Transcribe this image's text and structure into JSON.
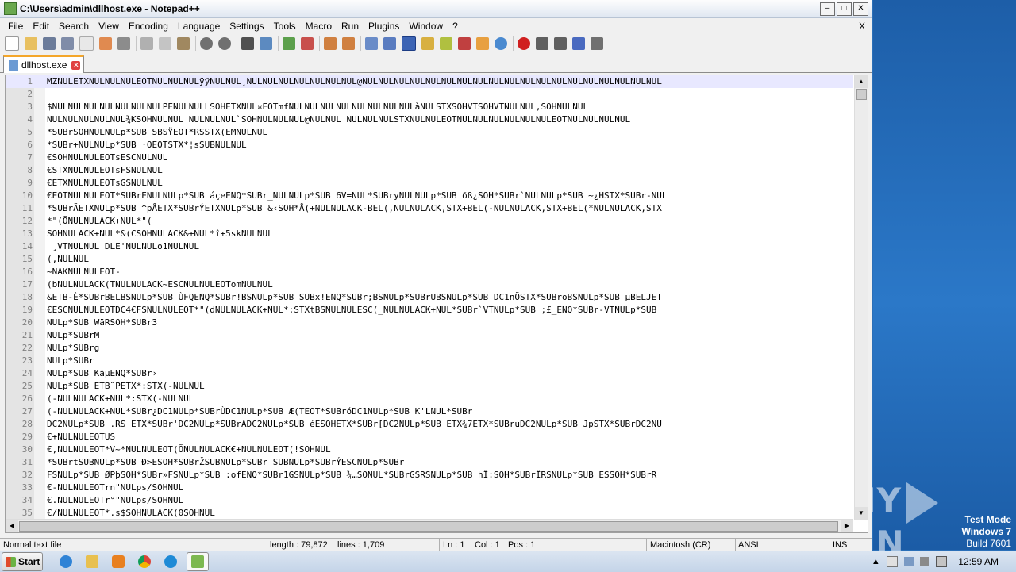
{
  "window": {
    "title": "C:\\Users\\admin\\dllhost.exe - Notepad++",
    "minimize": "0",
    "maximize": "1",
    "close": "r"
  },
  "menu": [
    "File",
    "Edit",
    "Search",
    "View",
    "Encoding",
    "Language",
    "Settings",
    "Tools",
    "Macro",
    "Run",
    "Plugins",
    "Window",
    "?"
  ],
  "menu_close": "X",
  "tab": {
    "label": "dllhost.exe",
    "close": "x"
  },
  "editor": {
    "lines": [
      {
        "n": "1",
        "t": "MZNULETXNULNULNULEOTNULNULNULÿÿNULNUL¸NULNULNULNULNULNULNUL@NULNULNULNULNULNULNULNULNULNULNULNULNULNULNULNULNULNULNUL"
      },
      {
        "n": "2",
        "t": ""
      },
      {
        "n": "3",
        "t": "$NULNULNULNULNULNULNULPENULNULLSOHETXNUL¤EOTmfNULNULNULNULNULNULNULNULàNULSTXSOHVTSOHVTNULNUL,SOHNULNUL"
      },
      {
        "n": "4",
        "t": "NULNULNULNULNUL¾KSOHNULNUL NULNULNUL`SOHNULNULNUL@NULNUL NULNULNULSTXNULNULEOTNULNULNULNULNULNULEOTNULNULNULNUL"
      },
      {
        "n": "5",
        "t": "*SUBrSOHNULNULp*SUB SBSŸEOT*RSSTX(EMNULNUL"
      },
      {
        "n": "6",
        "t": "*SUBr+NULNULp*SUB ·OEOTSTX*¦sSUBNULNUL"
      },
      {
        "n": "7",
        "t": "€SOHNULNULEOTsESCNULNUL"
      },
      {
        "n": "8",
        "t": "€STXNULNULEOTsFSNULNUL"
      },
      {
        "n": "9",
        "t": "€ETXNULNULEOTsGSNULNUL"
      },
      {
        "n": "10",
        "t": "€EOTNULNULEOT*SUBrENULNULp*SUB áçeENQ*SUBr_NULNULp*SUB 6V=NUL*SUBryNULNULp*SUB ðß¿SOH*SUBr`NULNULp*SUB ~¿HSTX*SUBr-NUL"
      },
      {
        "n": "11",
        "t": "*SUBrÃETXNULp*SUB ^pÅETX*SUBrÝETXNULp*SUB &‹SOH*Å(+NULNULACK-BEL(,NULNULACK,STX+BEL(-NULNULACK,STX+BEL(*NULNULACK,STX"
      },
      {
        "n": "12",
        "t": "*\"(ÕNULNULACK+NUL*\"("
      },
      {
        "n": "13",
        "t": "SOHNULACK+NUL*&(CSOHNULACK&+NUL*î+5skNULNUL"
      },
      {
        "n": "14",
        "t": " ¸VTNULNUL DLE'NULNULo1NULNUL"
      },
      {
        "n": "15",
        "t": "(,NULNUL"
      },
      {
        "n": "16",
        "t": "~NAKNULNULEOT-"
      },
      {
        "n": "17",
        "t": "(bNULNULACK(TNULNULACK~ESCNULNULEOTomNULNUL"
      },
      {
        "n": "18",
        "t": "&ETB-È*SUBrBELBSNULp*SUB ÙFQENQ*SUBr!BSNULp*SUB SUBx!ENQ*SUBr;BSNULp*SUBrUBSNULp*SUB DC1nÕSTX*SUBroBSNULp*SUB µBELJET"
      },
      {
        "n": "19",
        "t": "€ESCNULNULEOTDC4€FSNULNULEOT*\"(dNULNULACK+NUL*:STXtBSNULNULESC(_NULNULACK+NUL*SUBr`VTNULp*SUB ;£_ENQ*SUBr-VTNULp*SUB"
      },
      {
        "n": "20",
        "t": "NULp*SUB WäRSOH*SUBr3"
      },
      {
        "n": "21",
        "t": "NULp*SUBrM"
      },
      {
        "n": "22",
        "t": "NULp*SUBrg"
      },
      {
        "n": "23",
        "t": "NULp*SUBr"
      },
      {
        "n": "24",
        "t": "NULp*SUB KãµENQ*SUBr›"
      },
      {
        "n": "25",
        "t": "NULp*SUB ETB¨PETX*:STX(-NULNUL"
      },
      {
        "n": "26",
        "t": "(-NULNULACK+NUL*:STX(-NULNUL"
      },
      {
        "n": "27",
        "t": "(-NULNULACK+NUL*SUBr¿DC1NULp*SUBrÙDC1NULp*SUB Æ(TEOT*SUBróDC1NULp*SUB K'LNUL*SUBr"
      },
      {
        "n": "28",
        "t": "DC2NULp*SUB .RS ETX*SUBr'DC2NULp*SUBrADC2NULp*SUB éESOHETX*SUBr[DC2NULp*SUB ETX¾7ETX*SUBruDC2NULp*SUB JpSTX*SUBrDC2NU"
      },
      {
        "n": "29",
        "t": "€+NULNULEOTUS"
      },
      {
        "n": "30",
        "t": "€,NULNULEOT*V~*NULNULEOT(ÕNULNULACK€+NULNULEOT(!SOHNUL"
      },
      {
        "n": "31",
        "t": "*SUBrtSUBNULp*SUB Ð>ESOH*SUBrŽSUBNULp*SUBr¨SUBNULp*SUBrÝESCNULp*SUBr"
      },
      {
        "n": "32",
        "t": "FSNULp*SUB ØPþSOH*SUBr»FSNULp*SUB :ofENQ*SUBr1GSNULp*SUB ¾…SONUL*SUBrGSRSNULp*SUB hÏ:SOH*SUBrÎRSNULp*SUB ESSOH*SUBrR"
      },
      {
        "n": "33",
        "t": "€-NULNULEOTrn\"NULps/SOHNUL"
      },
      {
        "n": "34",
        "t": "€.NULNULEOTr°\"NULps/SOHNUL"
      },
      {
        "n": "35",
        "t": "€/NULNULEOT*.s$SOHNULACK(0SOHNUL"
      }
    ]
  },
  "status": {
    "type": "Normal text file",
    "length": "length : 79,872",
    "lines": "lines : 1,709",
    "ln": "Ln : 1",
    "col": "Col : 1",
    "pos": "Pos : 1",
    "eol": "Macintosh (CR)",
    "encoding": "ANSI",
    "ins": "INS"
  },
  "desktop": {
    "watermark": "ANY RUN",
    "test_mode": "Test Mode",
    "os": "Windows 7",
    "build": "Build 7601"
  },
  "taskbar": {
    "start": "Start",
    "clock": "12:59 AM"
  }
}
